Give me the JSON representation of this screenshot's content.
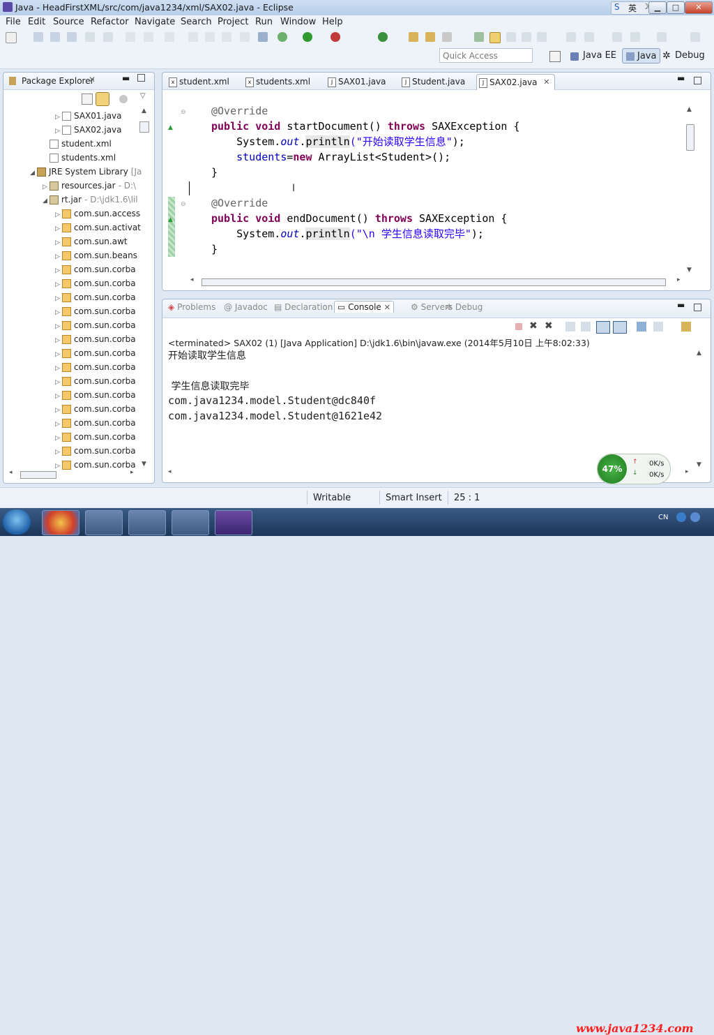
{
  "window": {
    "title": "Java - HeadFirstXML/src/com/java1234/xml/SAX02.java - Eclipse",
    "min": "▁",
    "max": "□",
    "close": "✕"
  },
  "ime": {
    "lang": "英"
  },
  "menu": [
    "File",
    "Edit",
    "Source",
    "Refactor",
    "Navigate",
    "Search",
    "Project",
    "Run",
    "Window",
    "Help"
  ],
  "quick_access": {
    "placeholder": "Quick Access"
  },
  "perspectives": {
    "javaee": "Java EE",
    "java": "Java",
    "debug": "Debug"
  },
  "package_explorer": {
    "title": "Package Explorer",
    "items": [
      {
        "label": "SAX01.java",
        "icon": "java-file-icon"
      },
      {
        "label": "SAX02.java",
        "icon": "java-file-icon"
      },
      {
        "label": "student.xml",
        "icon": "xml-file-icon"
      },
      {
        "label": "students.xml",
        "icon": "xml-file-icon"
      },
      {
        "label": "JRE System Library",
        "suffix": "[Ja",
        "icon": "library-icon"
      },
      {
        "label": "resources.jar",
        "suffix": "- D:\\",
        "icon": "jar-icon"
      },
      {
        "label": "rt.jar",
        "suffix": "- D:\\jdk1.6\\lil",
        "icon": "jar-icon"
      },
      {
        "label": "com.sun.access",
        "icon": "package-icon"
      },
      {
        "label": "com.sun.activat",
        "icon": "package-icon"
      },
      {
        "label": "com.sun.awt",
        "icon": "package-icon"
      },
      {
        "label": "com.sun.beans",
        "icon": "package-icon"
      },
      {
        "label": "com.sun.corba",
        "icon": "package-icon"
      },
      {
        "label": "com.sun.corba",
        "icon": "package-icon"
      },
      {
        "label": "com.sun.corba",
        "icon": "package-icon"
      },
      {
        "label": "com.sun.corba",
        "icon": "package-icon"
      },
      {
        "label": "com.sun.corba",
        "icon": "package-icon"
      },
      {
        "label": "com.sun.corba",
        "icon": "package-icon"
      },
      {
        "label": "com.sun.corba",
        "icon": "package-icon"
      },
      {
        "label": "com.sun.corba",
        "icon": "package-icon"
      },
      {
        "label": "com.sun.corba",
        "icon": "package-icon"
      },
      {
        "label": "com.sun.corba",
        "icon": "package-icon"
      },
      {
        "label": "com.sun.corba",
        "icon": "package-icon"
      },
      {
        "label": "com.sun.corba",
        "icon": "package-icon"
      },
      {
        "label": "com.sun.corba",
        "icon": "package-icon"
      },
      {
        "label": "com.sun.corba",
        "icon": "package-icon"
      },
      {
        "label": "com.sun.corba",
        "icon": "package-icon"
      }
    ]
  },
  "editor": {
    "tabs": [
      "student.xml",
      "students.xml",
      "SAX01.java",
      "Student.java",
      "SAX02.java"
    ],
    "active_tab": "SAX02.java",
    "code": {
      "l1_ann": "@Override",
      "l2_kw1": "public",
      "l2_kw2": "void",
      "l2_name": " startDocument() ",
      "l2_kw3": "throws",
      "l2_tail": " SAXException {",
      "l3_a": "    System.",
      "l3_out": "out",
      "l3_dot": ".",
      "l3_println": "println",
      "l3_str": "(\"开始读取学生信息\"",
      "l3_end": ");",
      "l4_a": "    ",
      "l4_fld": "students",
      "l4_eq": "=",
      "l4_kw": "new",
      "l4_tail": " ArrayList<Student>();",
      "l5": "}",
      "l7_ann": "@Override",
      "l8_kw1": "public",
      "l8_kw2": "void",
      "l8_name": " endDocument() ",
      "l8_kw3": "throws",
      "l8_tail": " SAXException {",
      "l9_a": "    System.",
      "l9_out": "out",
      "l9_dot": ".",
      "l9_println": "println",
      "l9_str": "(\"\\n 学生信息读取完毕\"",
      "l9_end": ");",
      "l10": "}"
    }
  },
  "console": {
    "tabs": [
      "Problems",
      "Javadoc",
      "Declaration",
      "Console",
      "Servers",
      "Debug"
    ],
    "active_tab": "Console",
    "header": "<terminated> SAX02 (1) [Java Application] D:\\jdk1.6\\bin\\javaw.exe (2014年5月10日 上午8:02:33)",
    "lines": [
      "开始读取学生信息",
      "",
      " 学生信息读取完毕",
      "com.java1234.model.Student@dc840f",
      "com.java1234.model.Student@1621e42"
    ]
  },
  "network_widget": {
    "percent": "47%",
    "up": "0K/s",
    "down": "0K/s"
  },
  "status": {
    "writable": "Writable",
    "insert": "Smart Insert",
    "position": "25 : 1"
  },
  "taskbar": {
    "tray_lang": "CN",
    "watermark": "www.java1234.com"
  }
}
